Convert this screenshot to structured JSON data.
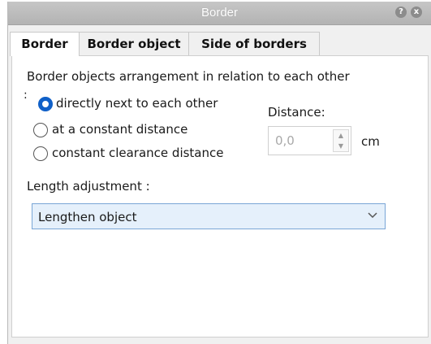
{
  "window": {
    "title": "Border",
    "help_symbol": "?",
    "close_symbol": "x"
  },
  "tabs": [
    {
      "label": "Border",
      "active": true
    },
    {
      "label": "Border object",
      "active": false
    },
    {
      "label": "Side of borders",
      "active": false
    }
  ],
  "arrangement": {
    "heading": "Border objects arrangement in relation to each other",
    "marker": ":",
    "options": [
      {
        "label": "directly next to each other",
        "selected": true
      },
      {
        "label": "at a constant distance",
        "selected": false
      },
      {
        "label": "constant clearance distance",
        "selected": false
      }
    ]
  },
  "distance": {
    "label": "Distance:",
    "value": "0,0",
    "unit": "cm",
    "enabled": false
  },
  "length_adjustment": {
    "label": "Length adjustment :",
    "selected": "Lengthen object"
  },
  "colors": {
    "accent": "#1060c8",
    "title_bar": "#bdbdbd",
    "select_bg": "#e5f0fb"
  }
}
